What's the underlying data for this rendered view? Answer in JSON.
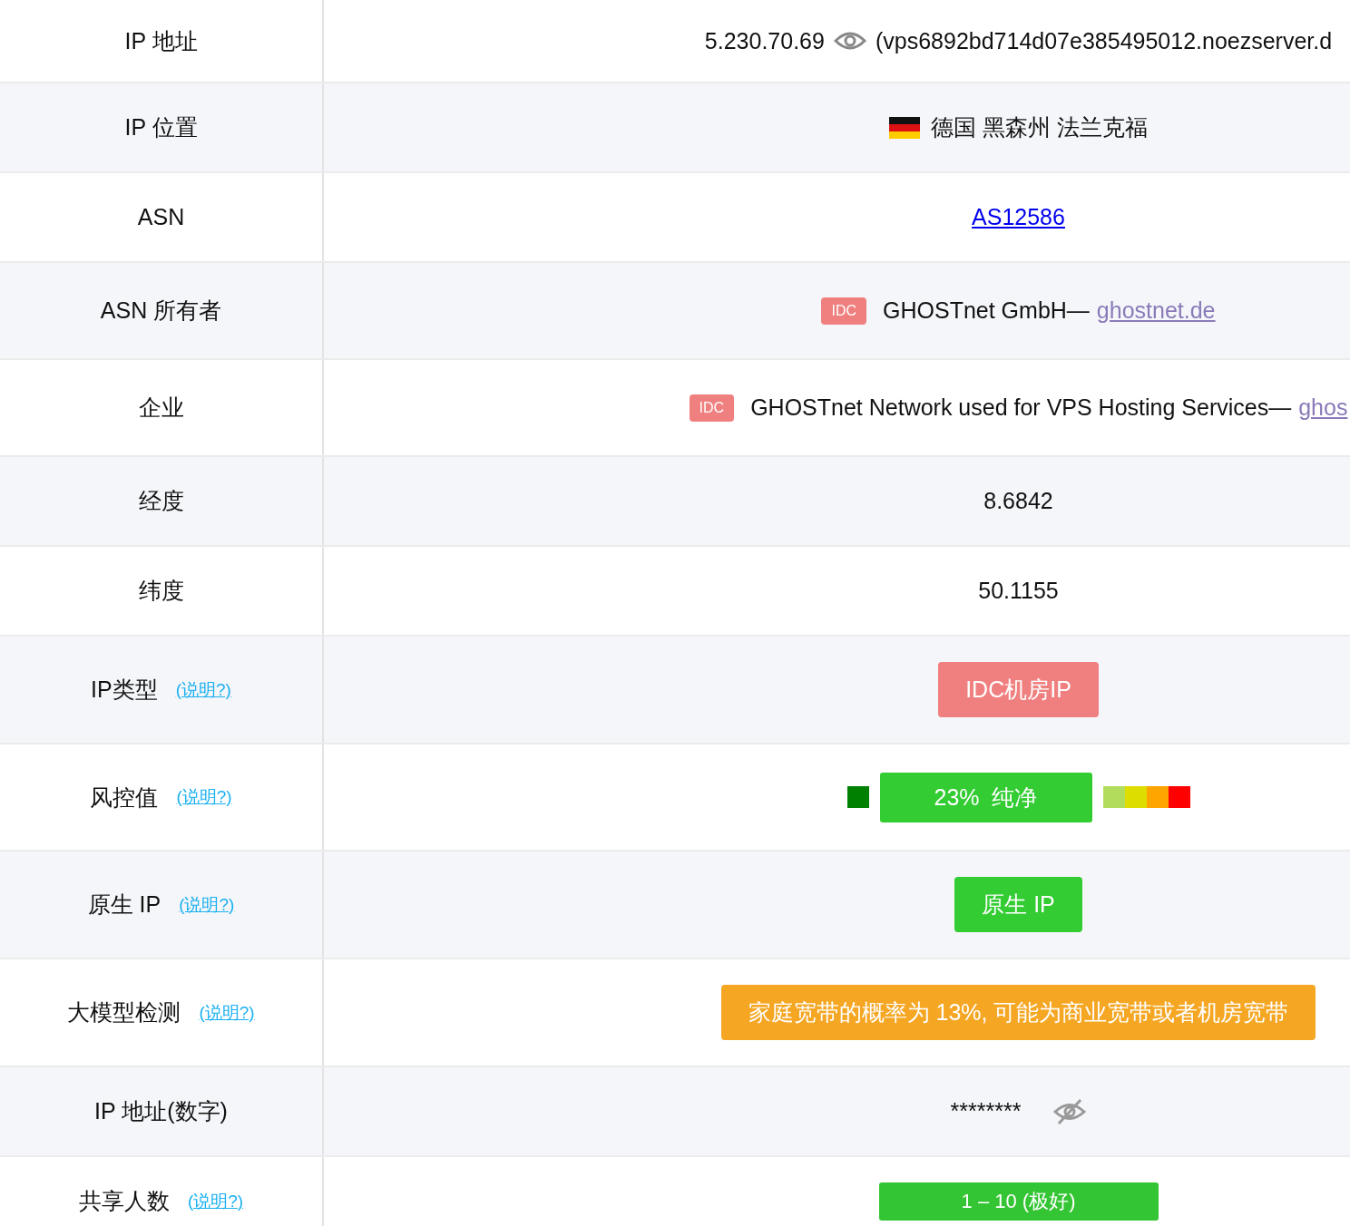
{
  "rows": [
    {
      "label": "IP 地址",
      "value": {
        "kind": "ip",
        "address": "5.230.70.69",
        "hostname": "(vps6892bd714d07e385495012.noezserver.d"
      }
    },
    {
      "label": "IP 位置",
      "value": {
        "kind": "location",
        "text": "德国 黑森州 法兰克福"
      }
    },
    {
      "label": "ASN",
      "value": {
        "kind": "link",
        "text": "AS12586"
      }
    },
    {
      "label": "ASN 所有者",
      "value": {
        "kind": "tag",
        "tag": "IDC",
        "text": "GHOSTnet GmbH—",
        "link": "ghostnet.de"
      }
    },
    {
      "label": "企业",
      "value": {
        "kind": "tag",
        "tag": "IDC",
        "text": "GHOSTnet Network used for VPS Hosting Services—",
        "link": "ghos"
      }
    },
    {
      "label": "经度",
      "value": {
        "kind": "text",
        "text": "8.6842"
      }
    },
    {
      "label": "纬度",
      "value": {
        "kind": "text",
        "text": "50.1155"
      }
    },
    {
      "label": "IP类型",
      "help": "(说明?)",
      "value": {
        "kind": "badge",
        "text": "IDC机房IP",
        "color": "#f08080"
      }
    },
    {
      "label": "风控值",
      "help": "(说明?)",
      "value": {
        "kind": "risk",
        "text": "23%  纯净",
        "color": "#33cc33",
        "scale_before": [
          {
            "color": "#008000"
          }
        ],
        "scale_after": [
          {
            "color": "#b2dd5c"
          },
          {
            "color": "#dddd00"
          },
          {
            "color": "#ffa500"
          },
          {
            "color": "#ff0000"
          }
        ]
      }
    },
    {
      "label": "原生 IP",
      "help": "(说明?)",
      "value": {
        "kind": "badge",
        "text": "原生 IP",
        "color": "#33cc33"
      }
    },
    {
      "label": "大模型检测",
      "help": "(说明?)",
      "value": {
        "kind": "badge",
        "text": "家庭宽带的概率为 13%, 可能为商业宽带或者机房宽带",
        "color": "#f5a623"
      }
    },
    {
      "label": "IP 地址(数字)",
      "value": {
        "kind": "masked",
        "text": "********"
      }
    },
    {
      "label": "共享人数",
      "help": "(说明?)",
      "value": {
        "kind": "pill",
        "text": "1 – 10 (极好)",
        "color": "#33c533"
      }
    }
  ]
}
